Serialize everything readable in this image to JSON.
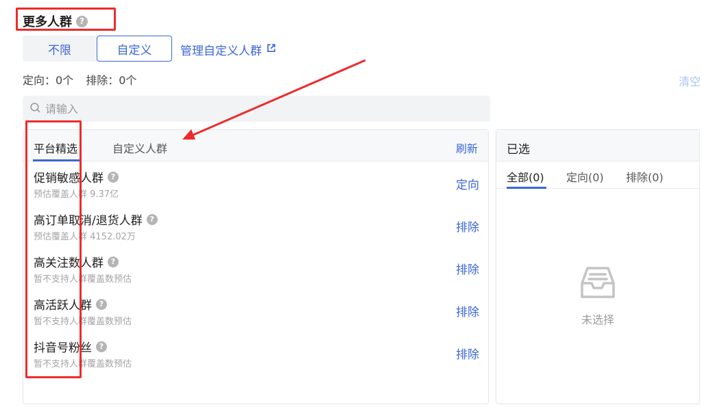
{
  "section": {
    "title": "更多人群",
    "help_icon": "question-circle-icon"
  },
  "segment": {
    "unlimited": "不限",
    "custom": "自定义"
  },
  "manage_link": {
    "label": "管理自定义人群",
    "icon": "external-link-icon"
  },
  "summary": {
    "target_label": "定向：",
    "target_count": "0个",
    "exclude_label": "排除：",
    "exclude_count": "0个"
  },
  "clear_label": "清空",
  "search": {
    "placeholder": "请输入",
    "value": "",
    "icon": "search-icon"
  },
  "left_panel": {
    "tabs": [
      {
        "label": "平台精选",
        "active": true
      },
      {
        "label": "自定义人群",
        "active": false
      }
    ],
    "refresh_label": "刷新",
    "rows": [
      {
        "name": "促销敏感人群",
        "sub": "预估覆盖人群 9.37亿",
        "action": "定向"
      },
      {
        "name": "高订单取消/退货人群",
        "sub": "预估覆盖人群 4152.02万",
        "action": "排除"
      },
      {
        "name": "高关注数人群",
        "sub": "暂不支持人群覆盖数预估",
        "action": "排除"
      },
      {
        "name": "高活跃人群",
        "sub": "暂不支持人群覆盖数预估",
        "action": "排除"
      },
      {
        "name": "抖音号粉丝",
        "sub": "暂不支持人群覆盖数预估",
        "action": "排除"
      }
    ]
  },
  "right_panel": {
    "title": "已选",
    "tabs": [
      {
        "label": "全部(0)",
        "active": true
      },
      {
        "label": "定向(0)",
        "active": false
      },
      {
        "label": "排除(0)",
        "active": false
      }
    ],
    "empty_icon": "inbox-icon",
    "empty_text": "未选择"
  },
  "colors": {
    "accent": "#3a66d8",
    "annotation": "#ec2c2c",
    "muted": "#a4a4a4",
    "panel_bg": "#f7f8fa"
  }
}
